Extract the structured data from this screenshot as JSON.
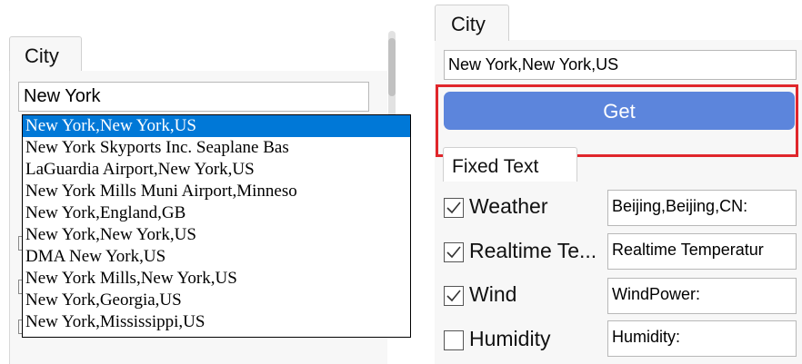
{
  "left": {
    "tab_label": "City",
    "city_input_value": "New York",
    "dropdown_items": [
      "New York,New York,US",
      "New York Skyports Inc. Seaplane Bas",
      "LaGuardia Airport,New York,US",
      "New York Mills Muni Airport,Minneso",
      "New York,England,GB",
      "New York,New York,US",
      "DMA New York,US",
      "New York Mills,New York,US",
      "New York,Georgia,US",
      "New York,Mississippi,US"
    ],
    "selected_index": 0
  },
  "right": {
    "tab_label": "City",
    "city_input_value": "New York,New York,US",
    "get_button_label": "Get",
    "fixed_text_tab_label": "Fixed Text",
    "options": [
      {
        "label": "Weather",
        "checked": true,
        "field_value": "Beijing,Beijing,CN:"
      },
      {
        "label": "Realtime Te...",
        "checked": true,
        "field_value": "Realtime Temperatur"
      },
      {
        "label": "Wind",
        "checked": true,
        "field_value": "WindPower:"
      },
      {
        "label": "Humidity",
        "checked": false,
        "field_value": "Humidity:"
      }
    ]
  },
  "colors": {
    "accent_button": "#5c85dc",
    "selection": "#0078d7",
    "highlight_border": "#e0262b"
  }
}
